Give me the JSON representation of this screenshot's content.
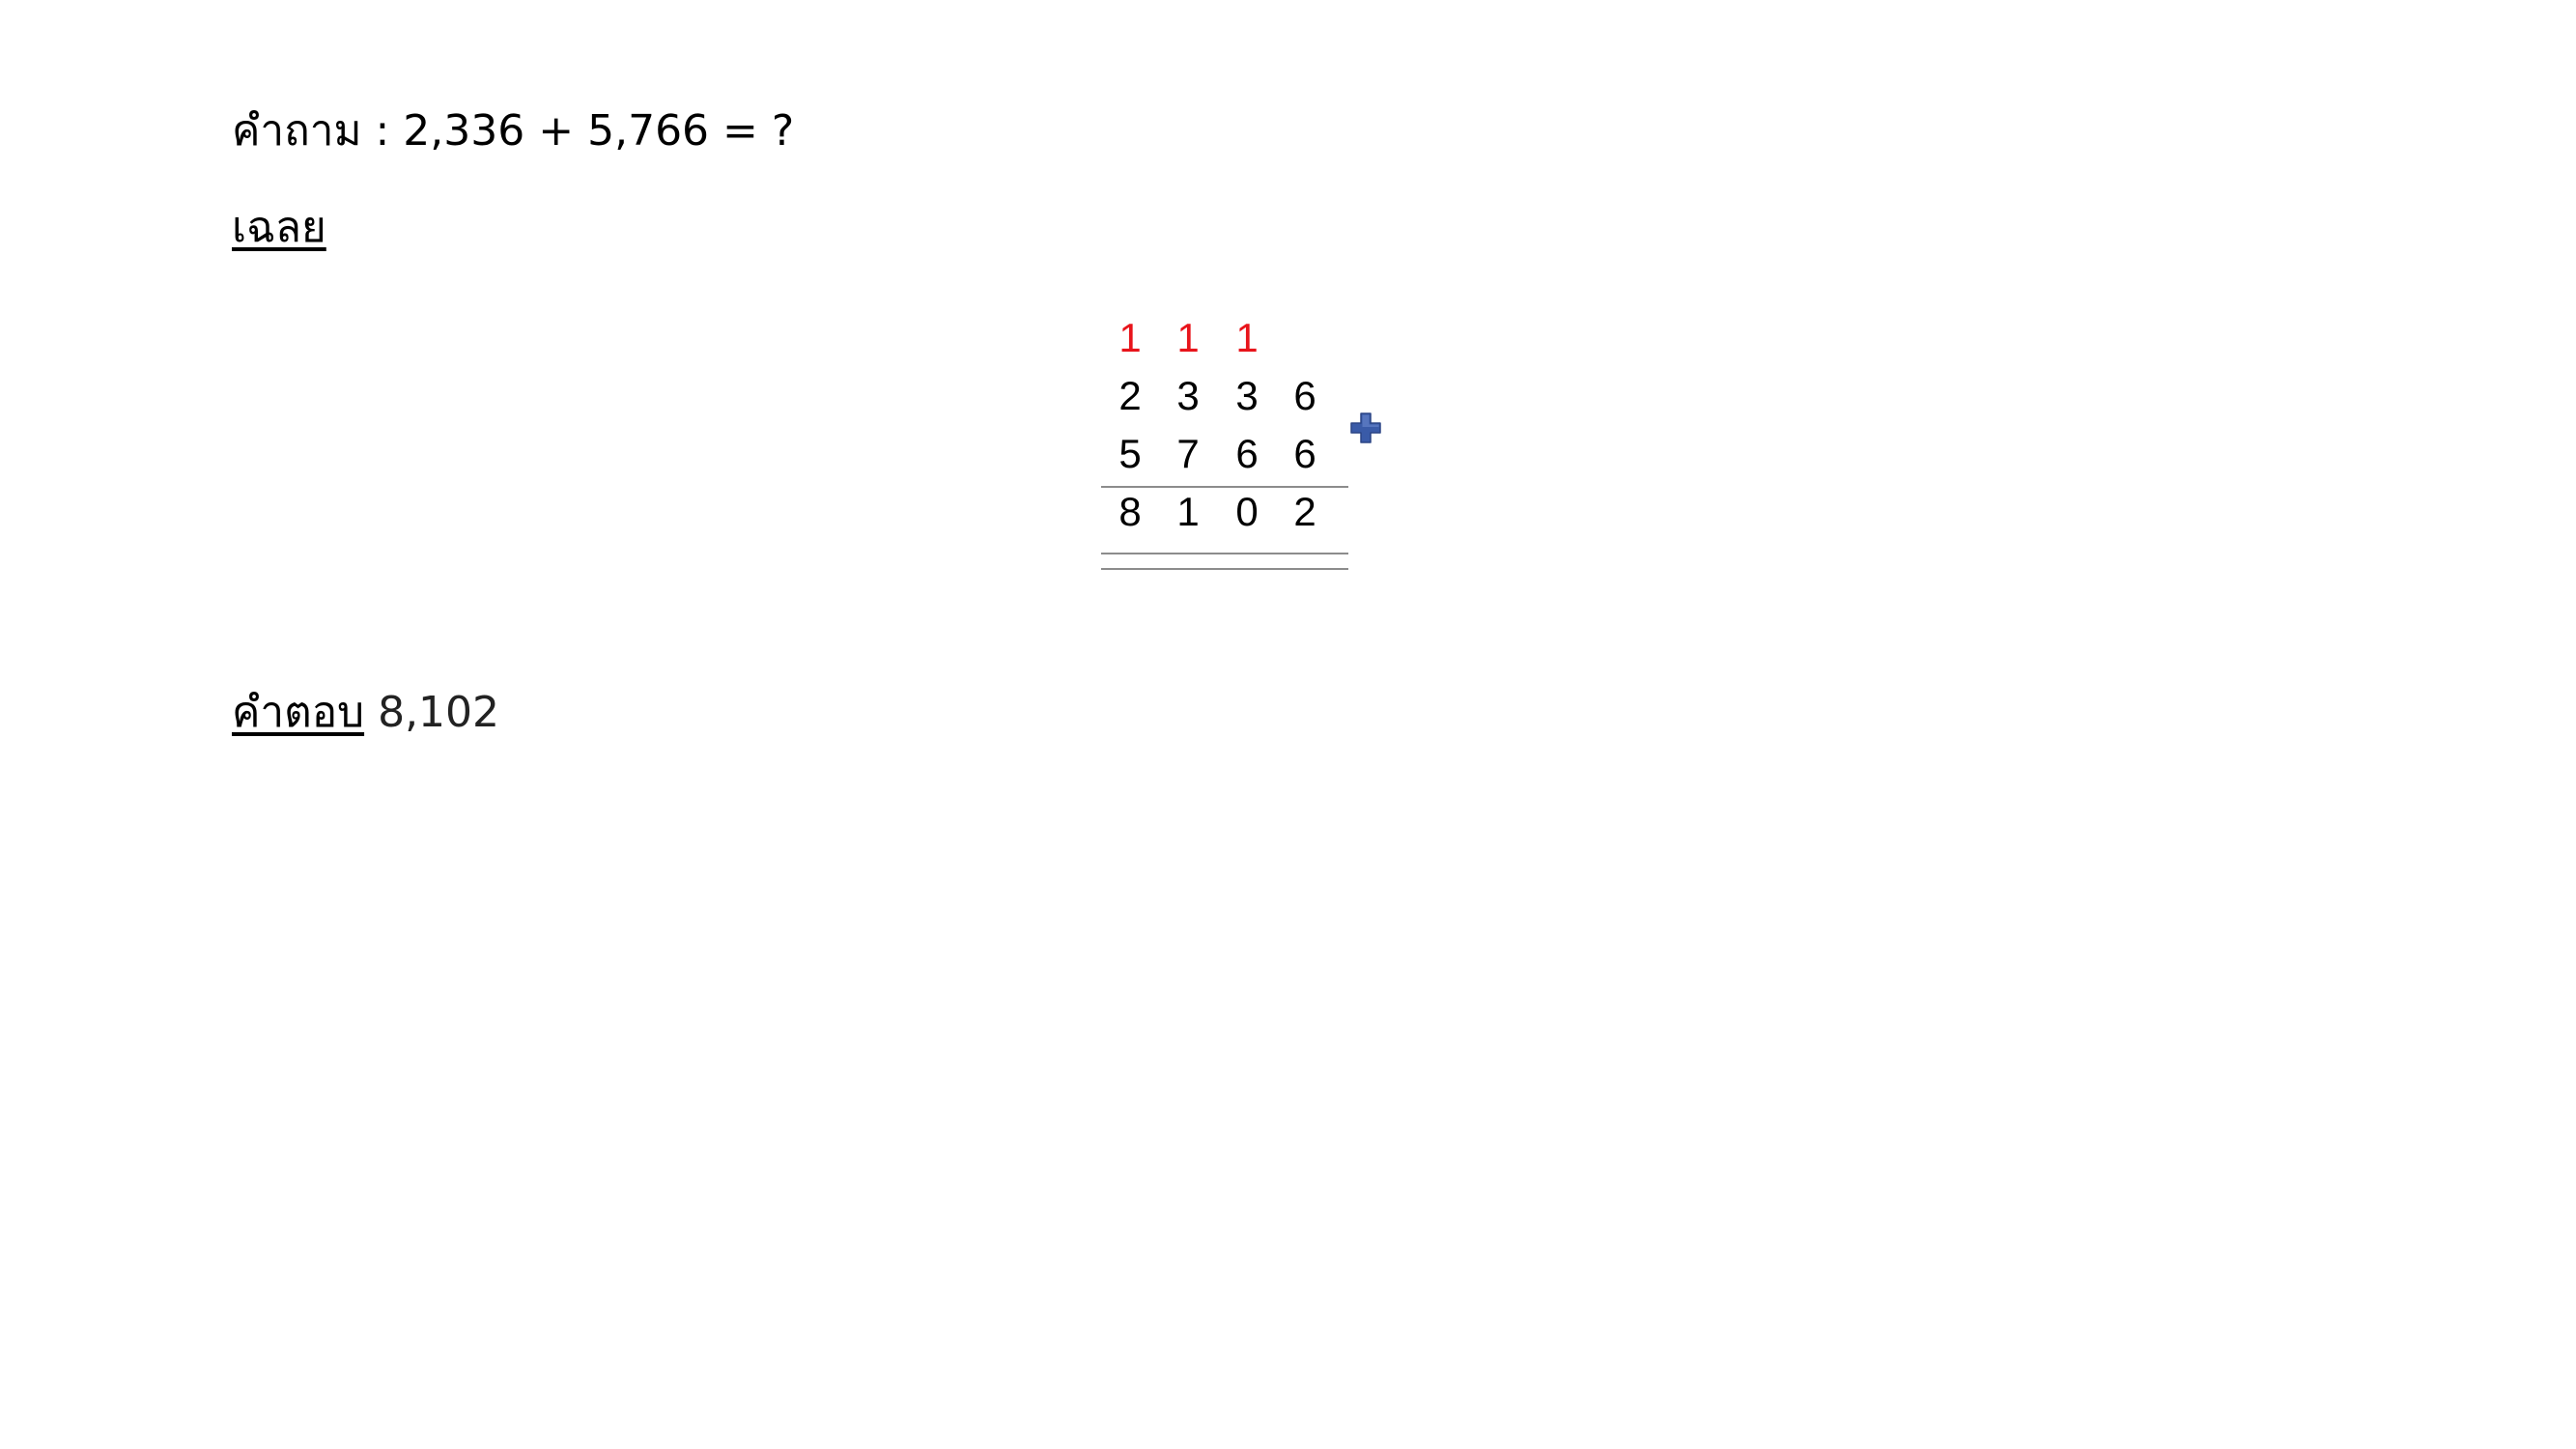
{
  "question": {
    "text": "คำถาม : 2,336 + 5,766 = ?"
  },
  "solution": {
    "heading": "เฉลย",
    "carry_digits": [
      "1",
      "1",
      "1"
    ],
    "addend_1_digits": [
      "2",
      "3",
      "3",
      "6"
    ],
    "addend_2_digits": [
      "5",
      "7",
      "6",
      "6"
    ],
    "result_digits": [
      "8",
      "1",
      "0",
      "2"
    ],
    "operator_icon": "plus-icon",
    "carry_color": "#e8141b",
    "operator_color": "#3a5ba8"
  },
  "answer": {
    "label": "คำตอบ",
    "value": "8,102"
  }
}
